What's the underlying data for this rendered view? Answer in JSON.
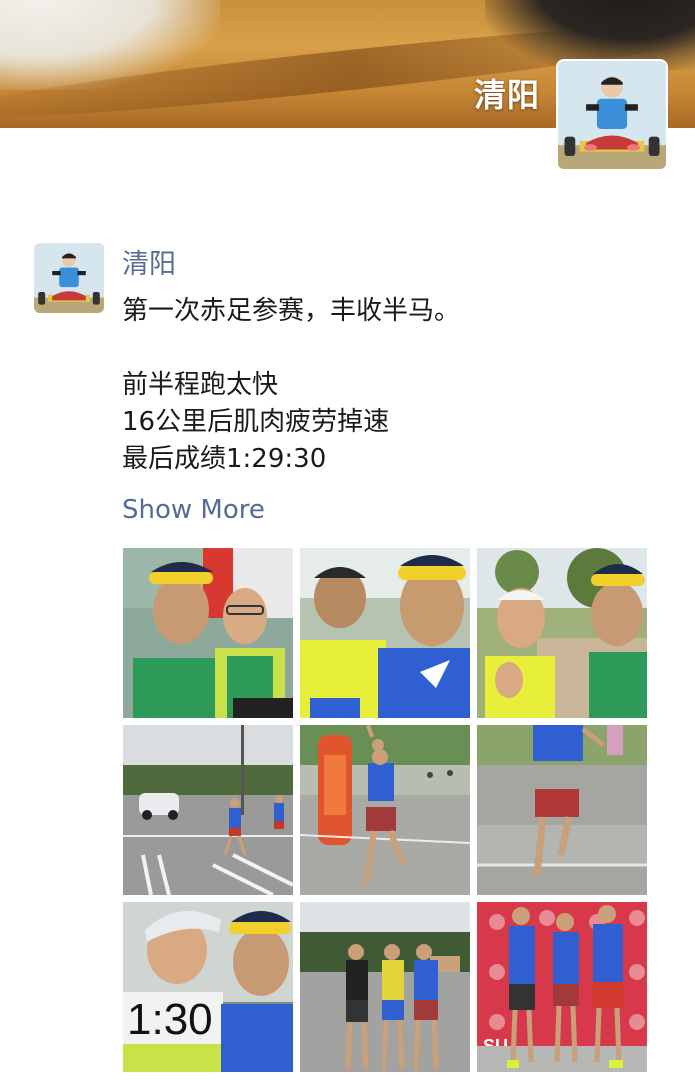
{
  "cover": {
    "name": "清阳",
    "avatar_alt": "avatar"
  },
  "post": {
    "author": "清阳",
    "lines": [
      "第一次赤足参赛，丰收半马。",
      "",
      "前半程跑太快",
      "16公里后肌肉疲劳掉速",
      "最后成绩1:29:30"
    ],
    "show_more": "Show More"
  },
  "photos": [
    {
      "kind": "selfie-flag"
    },
    {
      "kind": "selfie-two"
    },
    {
      "kind": "selfie-thumb"
    },
    {
      "kind": "road-runners"
    },
    {
      "kind": "runner-arch"
    },
    {
      "kind": "runner-finish"
    },
    {
      "kind": "selfie-bib",
      "bib_text": "1:30"
    },
    {
      "kind": "group-three"
    },
    {
      "kind": "podium-three",
      "banner_text": "SU"
    }
  ],
  "colors": {
    "link": "#576b95",
    "text": "#1a1a1a",
    "shirt_blue": "#2f5fd0",
    "shirt_green": "#2e9a5a",
    "neon": "#d7f13a"
  }
}
